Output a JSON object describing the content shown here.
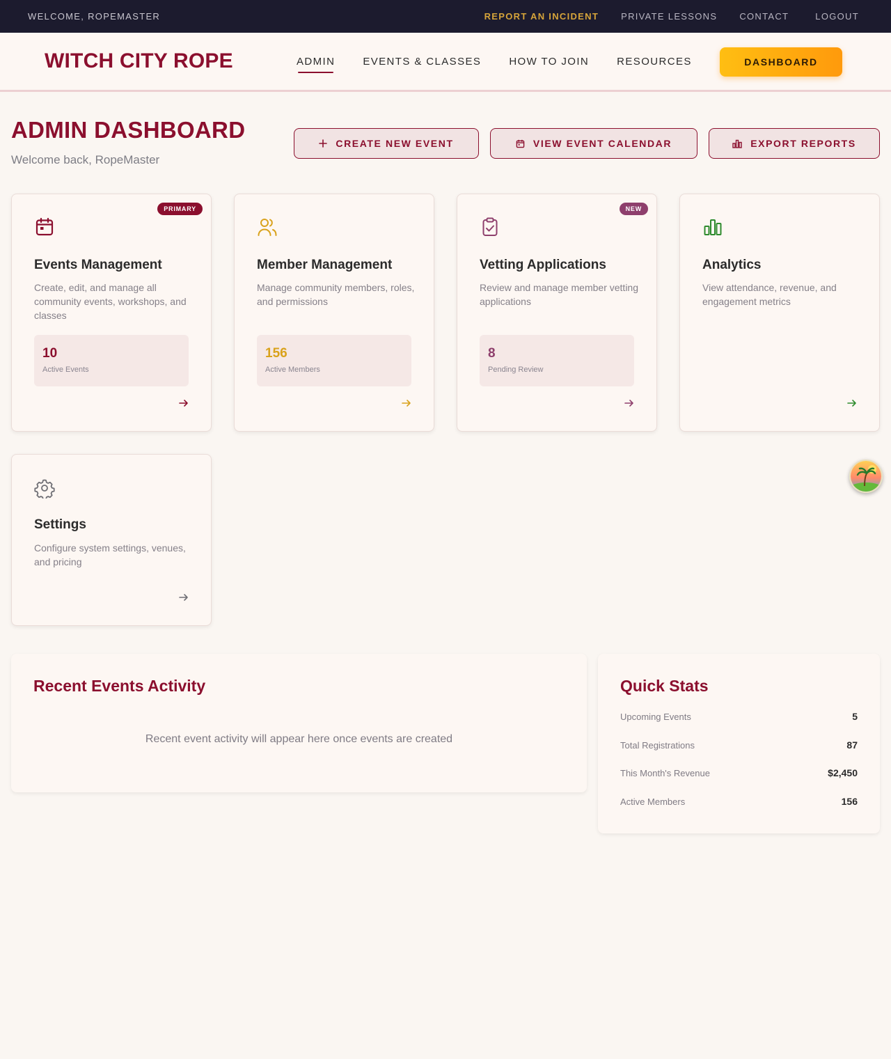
{
  "utility": {
    "welcome": "WELCOME, ROPEMASTER",
    "report": "REPORT AN INCIDENT",
    "private_lessons": "PRIVATE LESSONS",
    "contact": "CONTACT",
    "logout": "LOGOUT"
  },
  "header": {
    "logo": "WITCH CITY ROPE",
    "nav": [
      "ADMIN",
      "EVENTS & CLASSES",
      "HOW TO JOIN",
      "RESOURCES"
    ],
    "dashboard_button": "DASHBOARD"
  },
  "page": {
    "title": "ADMIN DASHBOARD",
    "subtitle": "Welcome back, RopeMaster",
    "actions": {
      "create": "CREATE NEW EVENT",
      "calendar": "VIEW EVENT CALENDAR",
      "export": "EXPORT REPORTS"
    }
  },
  "cards": [
    {
      "title": "Events Management",
      "description": "Create, edit, and manage all community events, workshops, and classes",
      "badge": "PRIMARY",
      "stat_value": "10",
      "stat_label": "Active Events",
      "icon": "calendar-icon",
      "color": "#8b0f2e"
    },
    {
      "title": "Member Management",
      "description": "Manage community members, roles, and permissions",
      "stat_value": "156",
      "stat_label": "Active Members",
      "icon": "users-icon",
      "color": "#d9a21c"
    },
    {
      "title": "Vetting Applications",
      "description": "Review and manage member vetting applications",
      "badge": "NEW",
      "stat_value": "8",
      "stat_label": "Pending Review",
      "icon": "clipboard-check-icon",
      "color": "#8e3f6c"
    },
    {
      "title": "Analytics",
      "description": "View attendance, revenue, and engagement metrics",
      "icon": "bar-chart-icon",
      "color": "#2e8b2e"
    },
    {
      "title": "Settings",
      "description": "Configure system settings, venues, and pricing",
      "icon": "gear-icon",
      "color": "#6f6f75"
    }
  ],
  "recent": {
    "title": "Recent Events Activity",
    "empty": "Recent event activity will appear here once events are created"
  },
  "quick_stats": {
    "title": "Quick Stats",
    "rows": [
      {
        "label": "Upcoming Events",
        "value": "5"
      },
      {
        "label": "Total Registrations",
        "value": "87"
      },
      {
        "label": "This Month's Revenue",
        "value": "$2,450"
      },
      {
        "label": "Active Members",
        "value": "156"
      }
    ]
  }
}
